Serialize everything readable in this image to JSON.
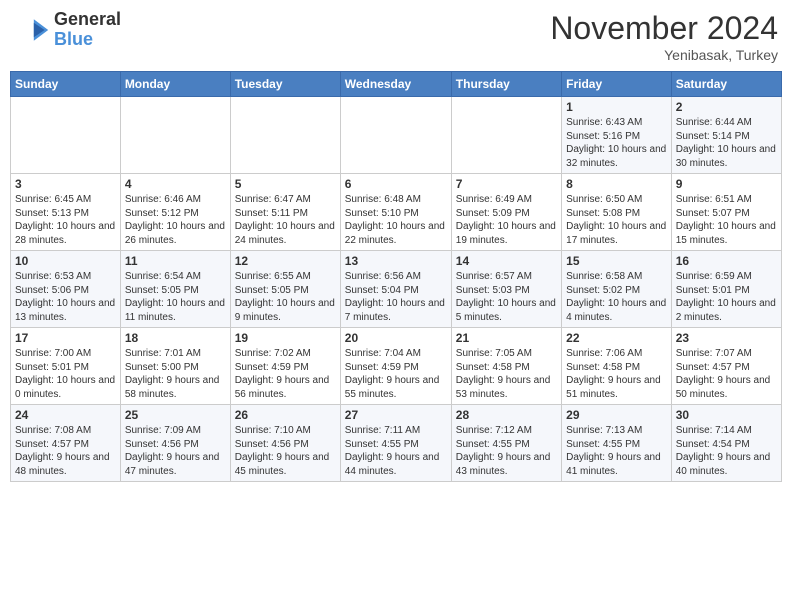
{
  "header": {
    "logo_general": "General",
    "logo_blue": "Blue",
    "month_title": "November 2024",
    "location": "Yenibasak, Turkey"
  },
  "weekdays": [
    "Sunday",
    "Monday",
    "Tuesday",
    "Wednesday",
    "Thursday",
    "Friday",
    "Saturday"
  ],
  "weeks": [
    [
      {
        "day": "",
        "info": ""
      },
      {
        "day": "",
        "info": ""
      },
      {
        "day": "",
        "info": ""
      },
      {
        "day": "",
        "info": ""
      },
      {
        "day": "",
        "info": ""
      },
      {
        "day": "1",
        "info": "Sunrise: 6:43 AM\nSunset: 5:16 PM\nDaylight: 10 hours and 32 minutes."
      },
      {
        "day": "2",
        "info": "Sunrise: 6:44 AM\nSunset: 5:14 PM\nDaylight: 10 hours and 30 minutes."
      }
    ],
    [
      {
        "day": "3",
        "info": "Sunrise: 6:45 AM\nSunset: 5:13 PM\nDaylight: 10 hours and 28 minutes."
      },
      {
        "day": "4",
        "info": "Sunrise: 6:46 AM\nSunset: 5:12 PM\nDaylight: 10 hours and 26 minutes."
      },
      {
        "day": "5",
        "info": "Sunrise: 6:47 AM\nSunset: 5:11 PM\nDaylight: 10 hours and 24 minutes."
      },
      {
        "day": "6",
        "info": "Sunrise: 6:48 AM\nSunset: 5:10 PM\nDaylight: 10 hours and 22 minutes."
      },
      {
        "day": "7",
        "info": "Sunrise: 6:49 AM\nSunset: 5:09 PM\nDaylight: 10 hours and 19 minutes."
      },
      {
        "day": "8",
        "info": "Sunrise: 6:50 AM\nSunset: 5:08 PM\nDaylight: 10 hours and 17 minutes."
      },
      {
        "day": "9",
        "info": "Sunrise: 6:51 AM\nSunset: 5:07 PM\nDaylight: 10 hours and 15 minutes."
      }
    ],
    [
      {
        "day": "10",
        "info": "Sunrise: 6:53 AM\nSunset: 5:06 PM\nDaylight: 10 hours and 13 minutes."
      },
      {
        "day": "11",
        "info": "Sunrise: 6:54 AM\nSunset: 5:05 PM\nDaylight: 10 hours and 11 minutes."
      },
      {
        "day": "12",
        "info": "Sunrise: 6:55 AM\nSunset: 5:05 PM\nDaylight: 10 hours and 9 minutes."
      },
      {
        "day": "13",
        "info": "Sunrise: 6:56 AM\nSunset: 5:04 PM\nDaylight: 10 hours and 7 minutes."
      },
      {
        "day": "14",
        "info": "Sunrise: 6:57 AM\nSunset: 5:03 PM\nDaylight: 10 hours and 5 minutes."
      },
      {
        "day": "15",
        "info": "Sunrise: 6:58 AM\nSunset: 5:02 PM\nDaylight: 10 hours and 4 minutes."
      },
      {
        "day": "16",
        "info": "Sunrise: 6:59 AM\nSunset: 5:01 PM\nDaylight: 10 hours and 2 minutes."
      }
    ],
    [
      {
        "day": "17",
        "info": "Sunrise: 7:00 AM\nSunset: 5:01 PM\nDaylight: 10 hours and 0 minutes."
      },
      {
        "day": "18",
        "info": "Sunrise: 7:01 AM\nSunset: 5:00 PM\nDaylight: 9 hours and 58 minutes."
      },
      {
        "day": "19",
        "info": "Sunrise: 7:02 AM\nSunset: 4:59 PM\nDaylight: 9 hours and 56 minutes."
      },
      {
        "day": "20",
        "info": "Sunrise: 7:04 AM\nSunset: 4:59 PM\nDaylight: 9 hours and 55 minutes."
      },
      {
        "day": "21",
        "info": "Sunrise: 7:05 AM\nSunset: 4:58 PM\nDaylight: 9 hours and 53 minutes."
      },
      {
        "day": "22",
        "info": "Sunrise: 7:06 AM\nSunset: 4:58 PM\nDaylight: 9 hours and 51 minutes."
      },
      {
        "day": "23",
        "info": "Sunrise: 7:07 AM\nSunset: 4:57 PM\nDaylight: 9 hours and 50 minutes."
      }
    ],
    [
      {
        "day": "24",
        "info": "Sunrise: 7:08 AM\nSunset: 4:57 PM\nDaylight: 9 hours and 48 minutes."
      },
      {
        "day": "25",
        "info": "Sunrise: 7:09 AM\nSunset: 4:56 PM\nDaylight: 9 hours and 47 minutes."
      },
      {
        "day": "26",
        "info": "Sunrise: 7:10 AM\nSunset: 4:56 PM\nDaylight: 9 hours and 45 minutes."
      },
      {
        "day": "27",
        "info": "Sunrise: 7:11 AM\nSunset: 4:55 PM\nDaylight: 9 hours and 44 minutes."
      },
      {
        "day": "28",
        "info": "Sunrise: 7:12 AM\nSunset: 4:55 PM\nDaylight: 9 hours and 43 minutes."
      },
      {
        "day": "29",
        "info": "Sunrise: 7:13 AM\nSunset: 4:55 PM\nDaylight: 9 hours and 41 minutes."
      },
      {
        "day": "30",
        "info": "Sunrise: 7:14 AM\nSunset: 4:54 PM\nDaylight: 9 hours and 40 minutes."
      }
    ]
  ]
}
